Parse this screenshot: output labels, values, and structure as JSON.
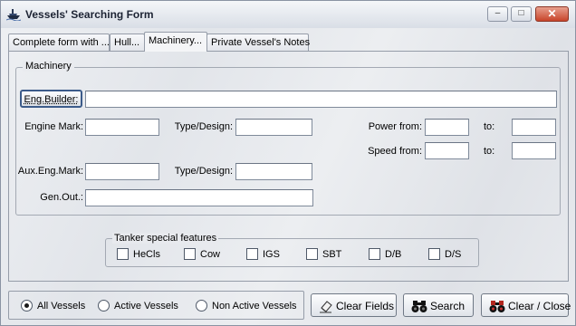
{
  "window": {
    "title": "Vessels' Searching Form",
    "icon": "ship-icon",
    "controls": {
      "minimize": "–",
      "maximize": "□",
      "close": "✕"
    }
  },
  "tabs": [
    {
      "label": "Complete form with ...",
      "active": false
    },
    {
      "label": "Hull...",
      "active": false
    },
    {
      "label": "Machinery...",
      "active": true
    },
    {
      "label": "Private Vessel's Notes",
      "active": false
    }
  ],
  "machinery": {
    "group_title": "Machinery",
    "eng_builder_button": "Eng.Builder:",
    "eng_builder_value": "",
    "engine_mark_label": "Engine Mark:",
    "engine_mark_value": "",
    "type_design_label_1": "Type/Design:",
    "type_design_value_1": "",
    "aux_eng_mark_label": "Aux.Eng.Mark:",
    "aux_eng_mark_value": "",
    "type_design_label_2": "Type/Design:",
    "type_design_value_2": "",
    "gen_out_label": "Gen.Out.:",
    "gen_out_value": "",
    "power_from_label": "Power from:",
    "power_from_value": "",
    "power_to_label": "to:",
    "power_to_value": "",
    "speed_from_label": "Speed from:",
    "speed_from_value": "",
    "speed_to_label": "to:",
    "speed_to_value": ""
  },
  "tanker": {
    "title": "Tanker special features",
    "options": [
      {
        "label": "HeCls",
        "checked": false
      },
      {
        "label": "Cow",
        "checked": false
      },
      {
        "label": "IGS",
        "checked": false
      },
      {
        "label": "SBT",
        "checked": false
      },
      {
        "label": "D/B",
        "checked": false
      },
      {
        "label": "D/S",
        "checked": false
      }
    ]
  },
  "vessel_filter": {
    "options": [
      {
        "label": "All Vessels",
        "selected": true
      },
      {
        "label": "Active Vessels",
        "selected": false
      },
      {
        "label": "Non Active Vessels",
        "selected": false
      }
    ]
  },
  "actions": {
    "clear_fields": {
      "label": "Clear Fields",
      "icon": "eraser-icon"
    },
    "search": {
      "label": "Search",
      "icon": "binoculars-icon"
    },
    "clear_close": {
      "label": "Clear / Close",
      "icon": "binoculars-close-icon"
    }
  },
  "colors": {
    "close_button": "#c8442a",
    "window_bg": "#e6e8ec"
  }
}
